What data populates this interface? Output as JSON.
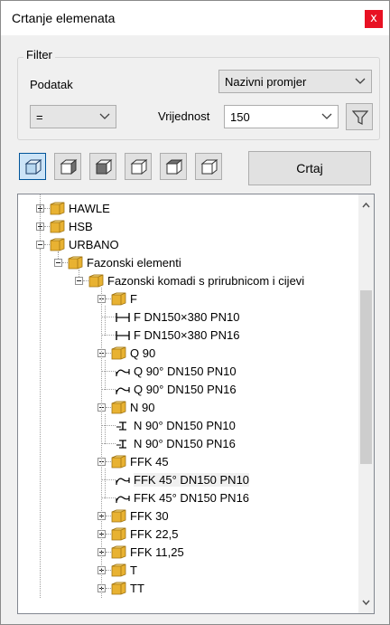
{
  "window": {
    "title": "Crtanje elemenata",
    "close_label": "x"
  },
  "filter": {
    "legend": "Filter",
    "podatak_label": "Podatak",
    "podatak_value": "Nazivni promjer",
    "operator_value": "=",
    "vrijednost_label": "Vrijednost",
    "vrijednost_value": "150"
  },
  "toolbar": {
    "view_buttons": [
      "view-front-icon",
      "view-left-icon",
      "view-top-icon",
      "view-right-icon",
      "view-back-icon",
      "view-iso-icon"
    ],
    "draw_label": "Crtaj"
  },
  "tree": {
    "nodes": [
      {
        "label": "HAWLE",
        "level": 1,
        "type": "folder",
        "expanded": false
      },
      {
        "label": "HSB",
        "level": 1,
        "type": "folder",
        "expanded": false
      },
      {
        "label": "URBANO",
        "level": 1,
        "type": "folder",
        "expanded": true
      },
      {
        "label": "Fazonski elementi",
        "level": 2,
        "type": "folder",
        "expanded": true
      },
      {
        "label": "Fazonski komadi s prirubnicom i cijevi",
        "level": 3,
        "type": "folder",
        "expanded": true
      },
      {
        "label": "F",
        "level": 4,
        "type": "folder",
        "expanded": true
      },
      {
        "label": "F DN150×380 PN10",
        "level": 5,
        "type": "leaf",
        "icon": "flange-pipe-icon"
      },
      {
        "label": "F DN150×380 PN16",
        "level": 5,
        "type": "leaf",
        "icon": "flange-pipe-icon"
      },
      {
        "label": "Q 90",
        "level": 4,
        "type": "folder",
        "expanded": true
      },
      {
        "label": "Q 90° DN150 PN10",
        "level": 5,
        "type": "leaf",
        "icon": "bend-icon"
      },
      {
        "label": "Q 90° DN150 PN16",
        "level": 5,
        "type": "leaf",
        "icon": "bend-icon"
      },
      {
        "label": "N 90",
        "level": 4,
        "type": "folder",
        "expanded": true
      },
      {
        "label": "N 90° DN150 PN10",
        "level": 5,
        "type": "leaf",
        "icon": "foot-bend-icon"
      },
      {
        "label": "N 90° DN150 PN16",
        "level": 5,
        "type": "leaf",
        "icon": "foot-bend-icon"
      },
      {
        "label": "FFK 45",
        "level": 4,
        "type": "folder",
        "expanded": true
      },
      {
        "label": "FFK 45° DN150 PN10",
        "level": 5,
        "type": "leaf",
        "icon": "bend-icon",
        "highlighted": true
      },
      {
        "label": "FFK 45° DN150 PN16",
        "level": 5,
        "type": "leaf",
        "icon": "bend-icon"
      },
      {
        "label": "FFK 30",
        "level": 4,
        "type": "folder",
        "expanded": false
      },
      {
        "label": "FFK 22,5",
        "level": 4,
        "type": "folder",
        "expanded": false
      },
      {
        "label": "FFK 11,25",
        "level": 4,
        "type": "folder",
        "expanded": false
      },
      {
        "label": "T",
        "level": 4,
        "type": "folder",
        "expanded": false
      },
      {
        "label": "TT",
        "level": 4,
        "type": "folder",
        "expanded": false
      }
    ]
  },
  "colors": {
    "close": "#e81123",
    "folder": "#e8b232",
    "active_button": "#cce4f7",
    "panel": "#f0f0f0"
  }
}
